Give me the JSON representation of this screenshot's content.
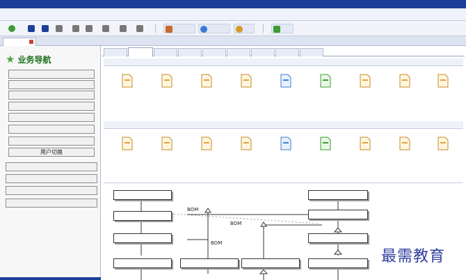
{
  "app": {
    "title": ""
  },
  "menubar": {
    "items": []
  },
  "toolbar": {
    "tools": [
      {
        "icon": "add-star-icon",
        "color": "#3f9b35"
      },
      {
        "icon": "arrow-down-icon",
        "color": "#1d3f97"
      },
      {
        "icon": "arrow-up-icon",
        "color": "#1d3f97"
      },
      {
        "icon": "scale-icon",
        "color": "#666666"
      },
      {
        "icon": "refresh-icon",
        "color": "#666666"
      },
      {
        "icon": "edit-icon",
        "color": "#666666"
      },
      {
        "icon": "print-icon",
        "color": "#666666"
      },
      {
        "icon": "up-arrow-icon",
        "color": "#666666"
      },
      {
        "icon": "tools-icon",
        "color": "#666666"
      },
      {
        "icon": "user-icon",
        "color": "#c96a2b",
        "label": ""
      },
      {
        "icon": "globe-icon",
        "color": "#3a7ad6",
        "label": ""
      },
      {
        "icon": "gear-icon",
        "color": "#d49a24",
        "label": ""
      },
      {
        "icon": "people-icon",
        "color": "#3f9b35",
        "label": ""
      }
    ]
  },
  "doc_tab": {
    "label": ""
  },
  "sidebar": {
    "title": "业务导航",
    "items": [
      {
        "label": ""
      },
      {
        "label": ""
      },
      {
        "label": ""
      },
      {
        "label": ""
      },
      {
        "label": ""
      },
      {
        "label": ""
      },
      {
        "label": ""
      },
      {
        "label": "用户切换"
      }
    ],
    "items2": [
      {
        "label": ""
      },
      {
        "label": ""
      },
      {
        "label": ""
      },
      {
        "label": ""
      }
    ]
  },
  "func_tabs": [
    {
      "label": "",
      "active": false
    },
    {
      "label": "",
      "active": true
    },
    {
      "label": "",
      "active": false
    },
    {
      "label": "",
      "active": false
    },
    {
      "label": "",
      "active": false
    },
    {
      "label": "",
      "active": false
    },
    {
      "label": "",
      "active": false
    },
    {
      "label": "",
      "active": false
    },
    {
      "label": "",
      "active": false
    }
  ],
  "section1": {
    "title": "",
    "items": [
      {
        "label": "",
        "icon": "doc-blank-icon",
        "color": "#e6a23a"
      },
      {
        "label": "",
        "icon": "doc-po-icon",
        "color": "#e6a23a"
      },
      {
        "label": "",
        "icon": "doc-in-icon",
        "color": "#e6a23a"
      },
      {
        "label": "",
        "icon": "doc-in-icon",
        "color": "#e6a23a"
      },
      {
        "label": "",
        "icon": "doc-arrow-icon",
        "color": "#3b7fd1"
      },
      {
        "label": "",
        "icon": "doc-recycle-icon",
        "color": "#3f9b35"
      },
      {
        "label": "",
        "icon": "doc-report-icon",
        "color": "#e6a23a"
      },
      {
        "label": "",
        "icon": "doc-sale-icon",
        "color": "#e6a23a"
      },
      {
        "label": "",
        "icon": "doc-sale-icon",
        "color": "#e6a23a"
      }
    ]
  },
  "section2": {
    "title": "",
    "items": [
      {
        "label": "",
        "icon": "list-blank-icon",
        "color": "#e6a23a"
      },
      {
        "label": "",
        "icon": "list-po-icon",
        "color": "#e6a23a"
      },
      {
        "label": "",
        "icon": "list-in-icon",
        "color": "#e6a23a"
      },
      {
        "label": "",
        "icon": "list-in-icon",
        "color": "#e6a23a"
      },
      {
        "label": "",
        "icon": "list-arrow-icon",
        "color": "#3b7fd1"
      },
      {
        "label": "",
        "icon": "list-recycle-icon",
        "color": "#3f9b35"
      },
      {
        "label": "",
        "icon": "list-report-icon",
        "color": "#e6a23a"
      },
      {
        "label": "",
        "icon": "list-sale-icon",
        "color": "#e6a23a"
      },
      {
        "label": "",
        "icon": "list-sale-icon",
        "color": "#e6a23a"
      }
    ]
  },
  "flowchart": {
    "label_center": "",
    "bom_labels": [
      "BOM",
      "BOM",
      "BOM"
    ],
    "left_nodes": [
      "",
      "",
      "",
      ""
    ],
    "right_nodes": [
      "",
      "",
      "",
      ""
    ],
    "bottom_nodes": [
      "",
      "",
      "",
      ""
    ],
    "bottom_small": ""
  },
  "watermark": {
    "text": "最需教育"
  }
}
